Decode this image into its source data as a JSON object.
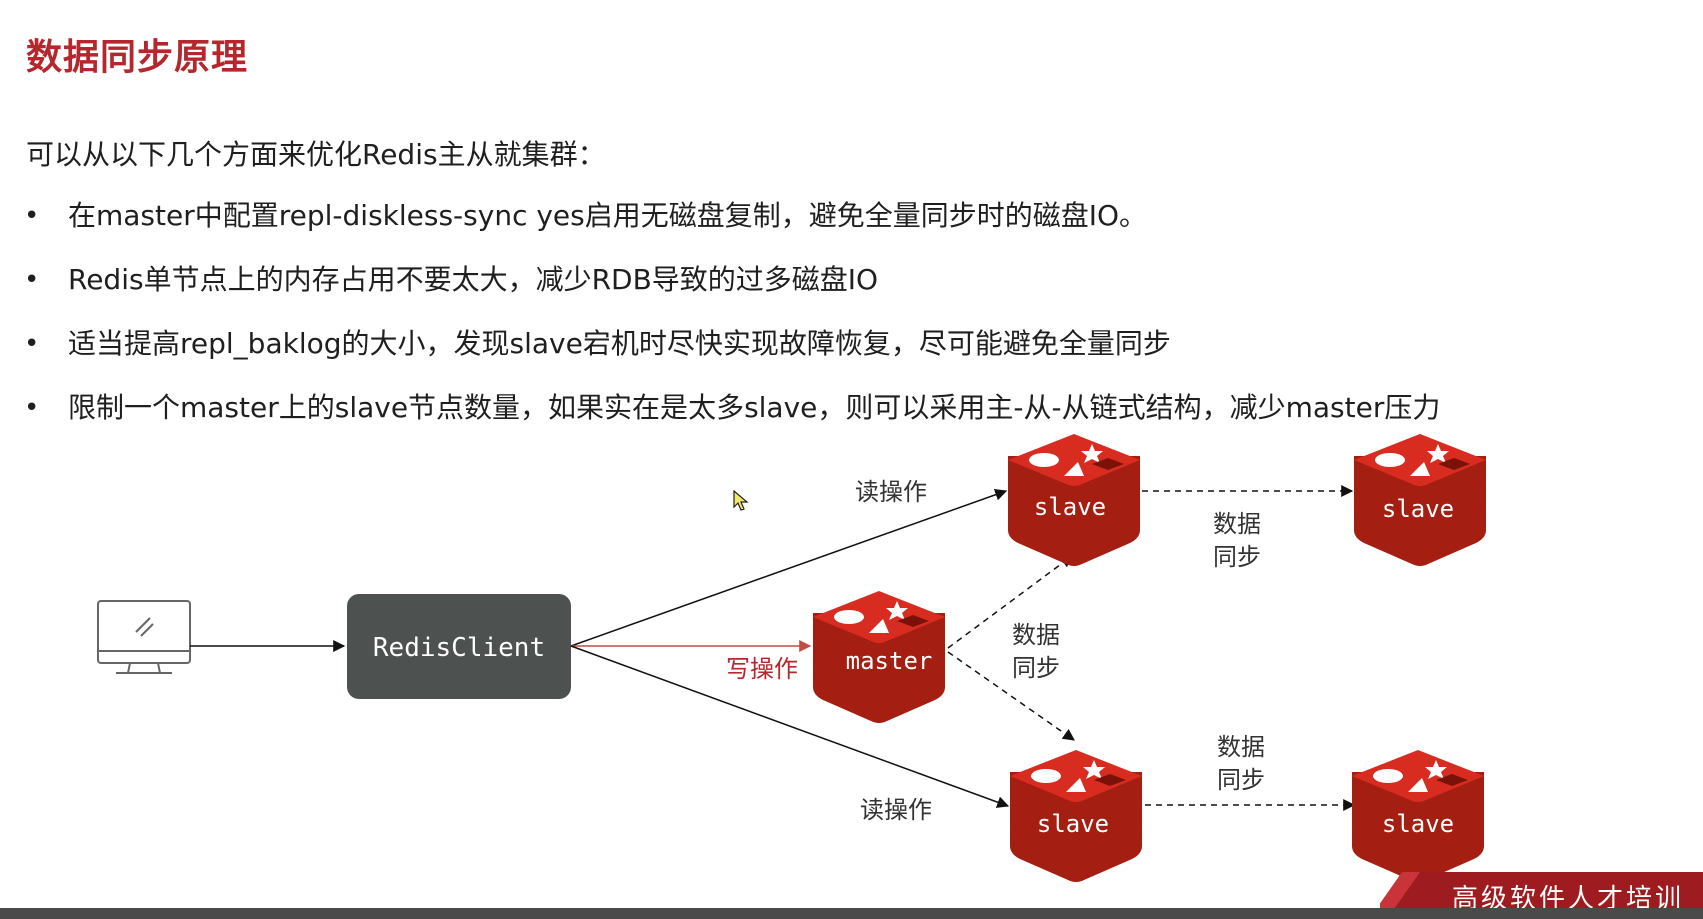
{
  "page": {
    "title": "数据同步原理",
    "intro": "可以从以下几个方面来优化Redis主从就集群：",
    "bullets": [
      "在master中配置repl-diskless-sync yes启用无磁盘复制，避免全量同步时的磁盘IO。",
      "Redis单节点上的内存占用不要太大，减少RDB导致的过多磁盘IO",
      "适当提高repl_baklog的大小，发现slave宕机时尽快实现故障恢复，尽可能避免全量同步",
      "限制一个master上的slave节点数量，如果实在是太多slave，则可以采用主-从-从链式结构，减少master压力"
    ]
  },
  "diagram": {
    "client_label": "RedisClient",
    "master_label": "master",
    "slave_label": "slave",
    "read_op": "读操作",
    "write_op": "写操作",
    "sync_line1": "数据",
    "sync_line2": "同步"
  },
  "brand": {
    "text": "高级软件人才培训"
  },
  "colors": {
    "accent": "#b5272d",
    "redis_red": "#d82c20",
    "client_box": "#4d5150"
  }
}
